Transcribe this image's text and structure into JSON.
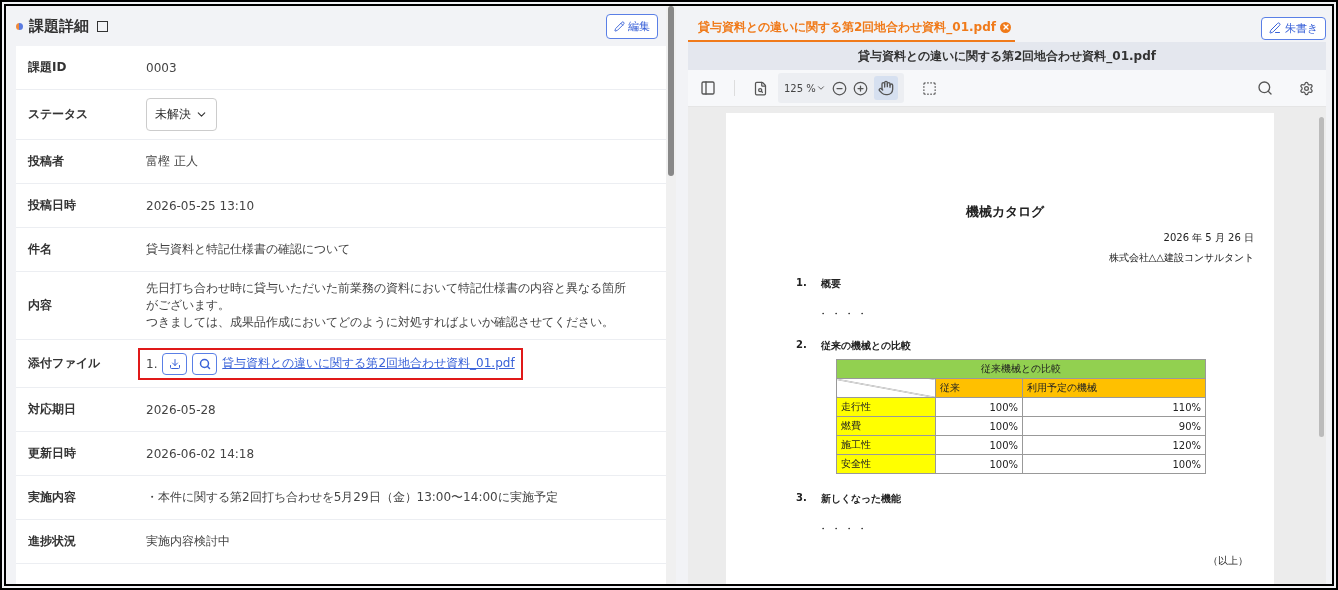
{
  "detail_panel": {
    "title": "課題詳細",
    "edit_button": "編集",
    "rows": [
      {
        "kind": "text",
        "label": "課題ID",
        "value": "0003"
      },
      {
        "kind": "select",
        "label": "ステータス",
        "value": "未解決"
      },
      {
        "kind": "text",
        "label": "投稿者",
        "value": "富樫 正人"
      },
      {
        "kind": "text",
        "label": "投稿日時",
        "value": "2026-05-25 13:10"
      },
      {
        "kind": "text",
        "label": "件名",
        "value": "貸与資料と特記仕様書の確認について"
      },
      {
        "kind": "multiline",
        "label": "内容",
        "lines": [
          "先日打ち合わせ時に貸与いただいた前業務の資料において特記仕様書の内容と異なる箇所がございます。",
          "つきましては、成果品作成においてどのように対処すればよいか確認させてください。"
        ]
      },
      {
        "kind": "attachment",
        "label": "添付ファイル",
        "number": "1.",
        "file": "貸与資料との違いに関する第2回地合わせ資料_01.pdf",
        "highlighted": true
      },
      {
        "kind": "text",
        "label": "対応期日",
        "value": "2026-05-28"
      },
      {
        "kind": "text",
        "label": "更新日時",
        "value": "2026-06-02 14:18"
      },
      {
        "kind": "text",
        "label": "実施内容",
        "value": "・本件に関する第2回打ち合わせを5月29日（金）13:00〜14:00に実施予定"
      },
      {
        "kind": "text",
        "label": "進捗状況",
        "value": "実施内容検討中"
      }
    ]
  },
  "viewer": {
    "tab": {
      "label": "貸与資料との違いに関する第2回地合わせ資料_01.pdf",
      "selected": true
    },
    "annotate_button": "朱書き",
    "title": "貸与資料との違いに関する第2回地合わせ資料_01.pdf",
    "zoom": "125 %",
    "hand_tool_selected": true,
    "document": {
      "title": "機械カタログ",
      "date": "2026 年 5 月 26 日",
      "company": "株式会社△△建設コンサルタント",
      "sections": [
        {
          "number": "1.",
          "heading": "概要",
          "body": "・・・・"
        },
        {
          "number": "2.",
          "heading": "従来の機械との比較",
          "kind": "table"
        },
        {
          "number": "3.",
          "heading": "新しくなった機能",
          "body": "・・・・"
        }
      ],
      "table": {
        "caption": "従来機械との比較",
        "columns": [
          "",
          "従来",
          "利用予定の機械"
        ],
        "rows": [
          [
            "走行性",
            "100%",
            "110%"
          ],
          [
            "燃費",
            "100%",
            "90%"
          ],
          [
            "施工性",
            "100%",
            "120%"
          ],
          [
            "安全性",
            "100%",
            "100%"
          ]
        ]
      },
      "closing": "（以上）"
    }
  }
}
